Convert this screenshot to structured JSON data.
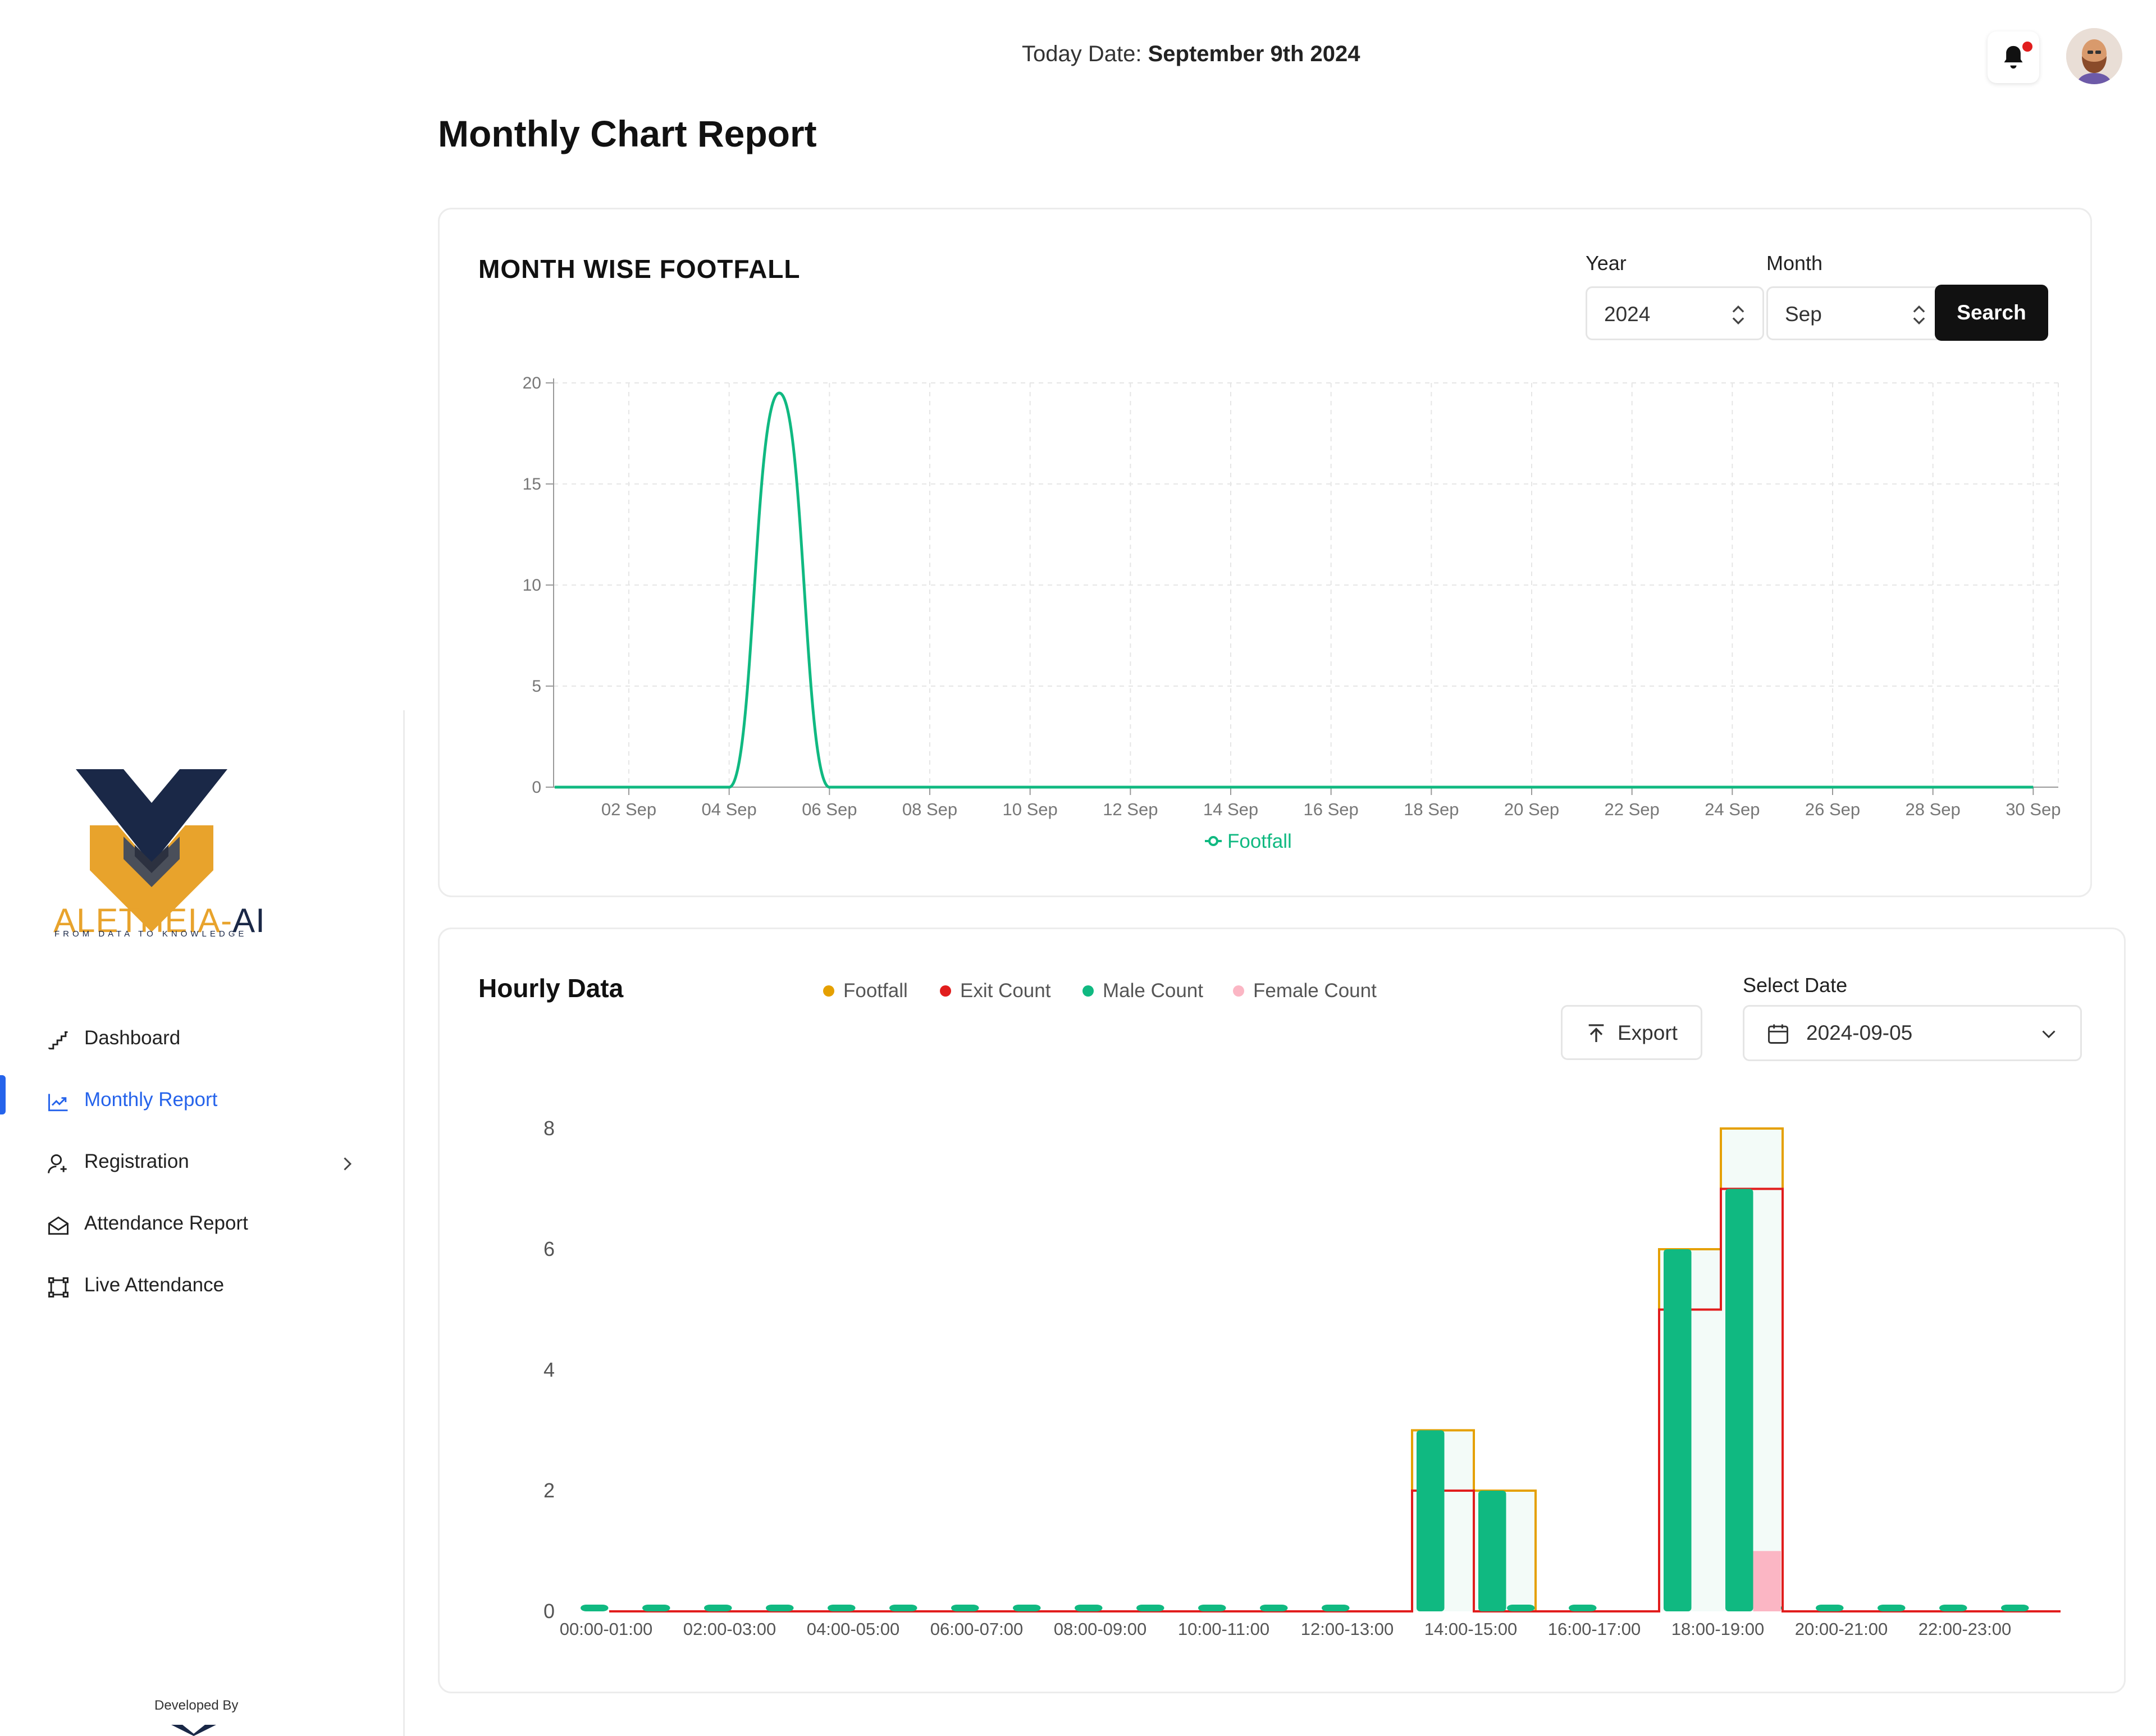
{
  "brand": {
    "name_main": "ALETHEIA-",
    "name_ai": "AI",
    "tagline": "FROM DATA TO KNOWLEDGE"
  },
  "sidebar": {
    "items": [
      {
        "label": "Dashboard",
        "icon": "stairs-chart-icon",
        "active": false
      },
      {
        "label": "Monthly Report",
        "icon": "trend-chart-icon",
        "active": true
      },
      {
        "label": "Registration",
        "icon": "user-add-icon",
        "active": false,
        "has_submenu": true
      },
      {
        "label": "Attendance Report",
        "icon": "envelope-open-icon",
        "active": false
      },
      {
        "label": "Live Attendance",
        "icon": "scan-frame-icon",
        "active": false
      }
    ],
    "developed_by": "Developed By"
  },
  "header": {
    "today_label": "Today Date:",
    "today_value": "September 9th 2024"
  },
  "page": {
    "title": "Monthly Chart Report"
  },
  "monthly": {
    "title": "MONTH WISE FOOTFALL",
    "year_label": "Year",
    "year_value": "2024",
    "month_label": "Month",
    "month_value": "Sep",
    "search_label": "Search"
  },
  "hourly": {
    "title": "Hourly Data",
    "export_label": "Export",
    "select_date_label": "Select Date",
    "date_value": "2024-09-05"
  },
  "colors": {
    "accent": "#2563eb",
    "footfall_line": "#10b981",
    "footfall_bar": "#e5a000",
    "exit": "#e11d1d",
    "male": "#10b981",
    "female": "#fbb6c4"
  },
  "chart_data": [
    {
      "type": "line",
      "x": [
        "01 Sep",
        "02 Sep",
        "03 Sep",
        "04 Sep",
        "05 Sep",
        "06 Sep",
        "07 Sep",
        "08 Sep",
        "09 Sep",
        "10 Sep",
        "11 Sep",
        "12 Sep",
        "13 Sep",
        "14 Sep",
        "15 Sep",
        "16 Sep",
        "17 Sep",
        "18 Sep",
        "19 Sep",
        "20 Sep",
        "21 Sep",
        "22 Sep",
        "23 Sep",
        "24 Sep",
        "25 Sep",
        "26 Sep",
        "27 Sep",
        "28 Sep",
        "29 Sep",
        "30 Sep"
      ],
      "x_tick_labels": [
        "02 Sep",
        "04 Sep",
        "06 Sep",
        "08 Sep",
        "10 Sep",
        "12 Sep",
        "14 Sep",
        "16 Sep",
        "18 Sep",
        "20 Sep",
        "22 Sep",
        "24 Sep",
        "26 Sep",
        "28 Sep",
        "30 Sep"
      ],
      "series": [
        {
          "name": "Footfall",
          "values": [
            0,
            0,
            0,
            0,
            19.5,
            0,
            0,
            0,
            0,
            0,
            0,
            0,
            0,
            0,
            0,
            0,
            0,
            0,
            0,
            0,
            0,
            0,
            0,
            0,
            0,
            0,
            0,
            0,
            0,
            0
          ]
        }
      ],
      "y_ticks": [
        0,
        5,
        10,
        15,
        20
      ],
      "ylim": [
        0,
        20
      ],
      "grid": true,
      "legend": "bottom-center"
    },
    {
      "type": "bar",
      "categories": [
        "00:00-01:00",
        "01:00-02:00",
        "02:00-03:00",
        "03:00-04:00",
        "04:00-05:00",
        "05:00-06:00",
        "06:00-07:00",
        "07:00-08:00",
        "08:00-09:00",
        "09:00-10:00",
        "10:00-11:00",
        "11:00-12:00",
        "12:00-13:00",
        "13:00-14:00",
        "14:00-15:00",
        "15:00-16:00",
        "16:00-17:00",
        "17:00-18:00",
        "18:00-19:00",
        "19:00-20:00",
        "20:00-21:00",
        "21:00-22:00",
        "22:00-23:00",
        "23:00-24:00"
      ],
      "x_tick_labels": [
        "00:00-01:00",
        "02:00-03:00",
        "04:00-05:00",
        "06:00-07:00",
        "08:00-09:00",
        "10:00-11:00",
        "12:00-13:00",
        "14:00-15:00",
        "16:00-17:00",
        "18:00-19:00",
        "20:00-21:00",
        "22:00-23:00"
      ],
      "series": [
        {
          "name": "Footfall",
          "style": "step",
          "values": [
            0,
            0,
            0,
            0,
            0,
            0,
            0,
            0,
            0,
            0,
            0,
            0,
            0,
            3,
            2,
            0,
            0,
            6,
            8,
            0,
            0,
            0,
            0,
            0
          ]
        },
        {
          "name": "Exit Count",
          "style": "step",
          "values": [
            0,
            0,
            0,
            0,
            0,
            0,
            0,
            0,
            0,
            0,
            0,
            0,
            0,
            2,
            0,
            0,
            0,
            5,
            7,
            0,
            0,
            0,
            0,
            0
          ]
        },
        {
          "name": "Male Count",
          "style": "bar",
          "values": [
            0,
            0,
            0,
            0,
            0,
            0,
            0,
            0,
            0,
            0,
            0,
            0,
            0,
            3,
            2,
            0,
            0,
            6,
            7,
            0,
            0,
            0,
            0,
            0
          ]
        },
        {
          "name": "Female Count",
          "style": "bar",
          "values": [
            0,
            0,
            0,
            0,
            0,
            0,
            0,
            0,
            0,
            0,
            0,
            0,
            0,
            0,
            0,
            0,
            0,
            0,
            1,
            0,
            0,
            0,
            0,
            0
          ]
        }
      ],
      "y_ticks": [
        0,
        2,
        4,
        6,
        8
      ],
      "ylim": [
        0,
        8
      ],
      "grid": false,
      "legend": "top"
    }
  ]
}
